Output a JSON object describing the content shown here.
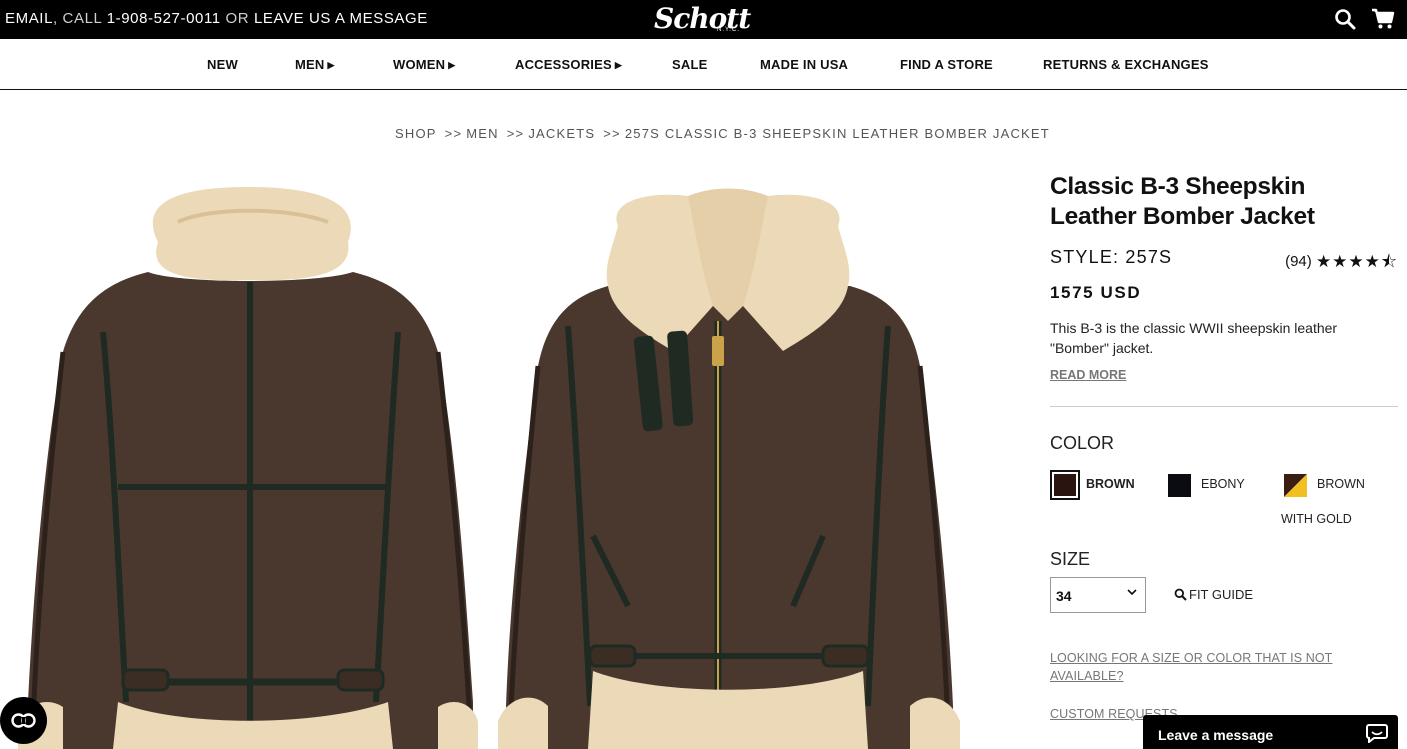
{
  "topbar": {
    "email_label": "EMAIL",
    "call_label": ", CALL ",
    "phone": "1-908-527-0011",
    "or_label": " OR ",
    "message_label": "LEAVE US A MESSAGE",
    "logo_text": "Schott",
    "logo_sub": "N.Y.C.",
    "search_icon": "search-icon",
    "cart_icon": "cart-icon"
  },
  "nav": {
    "items": [
      {
        "label": "NEW",
        "has_submenu": false
      },
      {
        "label": "MEN",
        "has_submenu": true
      },
      {
        "label": "WOMEN",
        "has_submenu": true
      },
      {
        "label": "ACCESSORIES",
        "has_submenu": true
      },
      {
        "label": "SALE",
        "has_submenu": false
      },
      {
        "label": "MADE IN USA",
        "has_submenu": false
      },
      {
        "label": "FIND A STORE",
        "has_submenu": false
      },
      {
        "label": "RETURNS & EXCHANGES",
        "has_submenu": false
      }
    ],
    "submenu_arrow": "▶"
  },
  "breadcrumb": {
    "items": [
      "SHOP",
      "MEN",
      "JACKETS",
      "257S CLASSIC B-3 SHEEPSKIN LEATHER BOMBER JACKET"
    ],
    "separator": ">>"
  },
  "product": {
    "title": "Classic B-3 Sheepskin Leather Bomber Jacket",
    "style": "STYLE: 257S",
    "review_count": "(94)",
    "rating": 4.5,
    "stars_text": "★★★★⯪",
    "price": "1575 USD",
    "description": "This B-3 is the classic WWII sheepskin leather \"Bomber\" jacket.",
    "read_more": "READ MORE",
    "color_label": "COLOR",
    "colors": [
      {
        "label": "BROWN",
        "hex": "#2a1410",
        "selected": true
      },
      {
        "label": "EBONY",
        "hex": "#0b0b12",
        "selected": false
      },
      {
        "label": "BROWN",
        "label2": "WITH GOLD",
        "hex": "#3a1e12",
        "accent": "#f0c020",
        "selected": false
      }
    ],
    "size_label": "SIZE",
    "size_value": "34",
    "fit_guide": "FIT GUIDE",
    "not_available_link": "LOOKING FOR A SIZE OR COLOR THAT IS NOT AVAILABLE?",
    "custom_requests": "CUSTOM REQUESTS"
  },
  "widgets": {
    "accessibility_icon": "accessibility-icon",
    "chat_label": "Leave a message",
    "chat_icon": "chat-bubble-icon"
  },
  "colors": {
    "topbar_bg": "#000000",
    "leather": "#4a382e",
    "fur": "#ecd9b8"
  }
}
